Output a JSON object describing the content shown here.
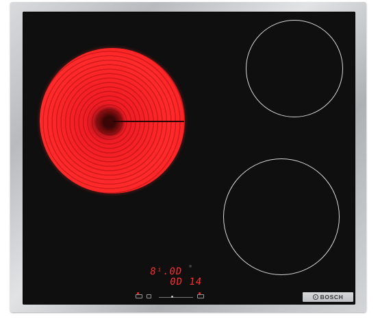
{
  "appliance": {
    "brand": "BOSCH",
    "model_code": "",
    "badge_lines": [
      "",
      "",
      ""
    ]
  },
  "display": {
    "top_line": "8ⁱ.0D",
    "bottom_line": "0D 14"
  },
  "colors": {
    "glass": "#0f0f0f",
    "frame": "#c4c6c8",
    "heating_zone_active": "#ff2a2a",
    "display_led": "#ff3030",
    "zone_outline": "#d9d9d9"
  },
  "zones": [
    {
      "name": "front-left",
      "state": "active-hot"
    },
    {
      "name": "rear-right",
      "state": "off"
    },
    {
      "name": "front-right",
      "state": "off"
    }
  ],
  "icons": {
    "brand": "bosch-armature-logo-icon",
    "indicator": "led-dot-icon"
  }
}
